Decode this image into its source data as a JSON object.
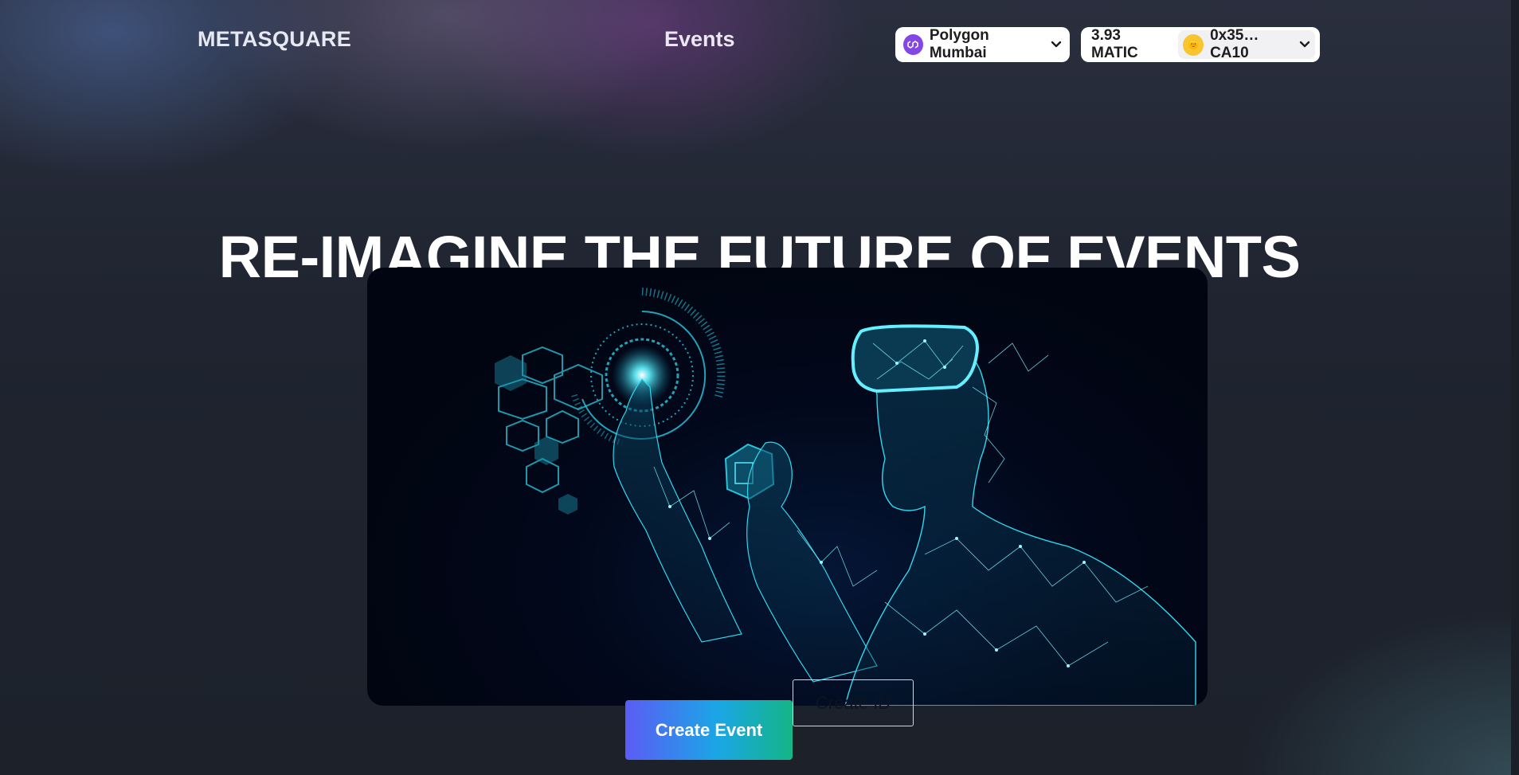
{
  "brand": {
    "name": "METASQUARE"
  },
  "nav": {
    "events_label": "Events"
  },
  "network": {
    "name": "Polygon Mumbai",
    "icon": "polygon-icon",
    "color": "#8247e5"
  },
  "account": {
    "balance": "3.93 MATIC",
    "address": "0x35…CA10",
    "avatar_color": "#f7c531"
  },
  "hero": {
    "headline": "RE-IMAGINE THE FUTURE OF EVENTS",
    "image": "vr-headset-person-illustration"
  },
  "actions": {
    "create_event_label": "Create Event",
    "create_id_label": "Create ID"
  },
  "colors": {
    "accent_start": "#5b5cf5",
    "accent_mid": "#1aa6e6",
    "accent_end": "#15b586",
    "glow": "#22d3e6"
  }
}
